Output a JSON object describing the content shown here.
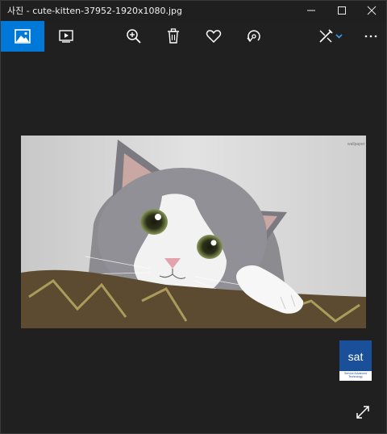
{
  "window": {
    "title": "사진 - cute-kitten-37952-1920x1080.jpg",
    "controls": [
      "minimize-icon",
      "maximize-icon",
      "close-icon"
    ]
  },
  "toolbar": {
    "buttons": [
      {
        "name": "view-photos-icon",
        "active": true
      },
      {
        "name": "slideshow-icon"
      },
      {
        "name": "zoom-icon"
      },
      {
        "name": "delete-icon"
      },
      {
        "name": "favorite-icon"
      },
      {
        "name": "rotate-icon"
      },
      {
        "name": "edit-create-icon"
      },
      {
        "name": "more-options-icon"
      }
    ],
    "accent_color": "#0078d7"
  },
  "photo": {
    "subject": "gray and white kitten on patterned cushion",
    "watermark": "wallpaper",
    "colors": {
      "wall": "#d9d9d9",
      "fur_gray": "#8a8a8e",
      "cushion": "#5a4a30"
    }
  },
  "overlay_logo": {
    "text": "sat",
    "subtext": "Service Advanced Technology"
  }
}
